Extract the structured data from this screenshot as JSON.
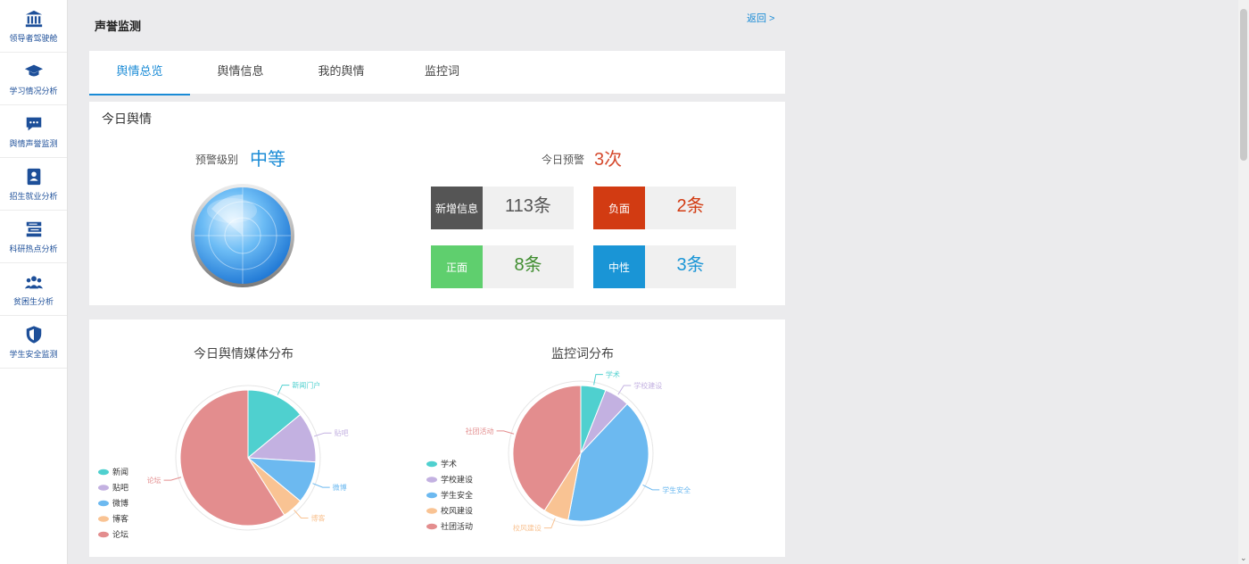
{
  "sidebar": {
    "items": [
      {
        "label": "领导者驾驶舱",
        "icon": "bank-icon"
      },
      {
        "label": "学习情况分析",
        "icon": "graduation-cap-icon"
      },
      {
        "label": "舆情声誉监测",
        "icon": "chat-bubble-icon"
      },
      {
        "label": "招生就业分析",
        "icon": "person-badge-icon"
      },
      {
        "label": "科研热点分析",
        "icon": "server-stack-icon"
      },
      {
        "label": "贫困生分析",
        "icon": "group-icon"
      },
      {
        "label": "学生安全监测",
        "icon": "shield-icon"
      }
    ],
    "accent": "#1d4f99"
  },
  "header": {
    "title": "声誉监测",
    "back": "返回 >"
  },
  "tabs": [
    {
      "label": "舆情总览",
      "active": true
    },
    {
      "label": "舆情信息",
      "active": false
    },
    {
      "label": "我的舆情",
      "active": false
    },
    {
      "label": "监控词",
      "active": false
    }
  ],
  "today": {
    "title": "今日舆情",
    "level_label": "预警级别",
    "level_value": "中等",
    "alert_label": "今日预警",
    "alert_value": "3次",
    "stats": [
      {
        "tag": "新增信息",
        "value": "113条",
        "tag_color": "#555555",
        "value_color": "#555555"
      },
      {
        "tag": "负面",
        "value": "2条",
        "tag_color": "#d23b12",
        "value_color": "#d23b12"
      },
      {
        "tag": "正面",
        "value": "8条",
        "tag_color": "#5fcf6e",
        "value_color": "#3f8d2f"
      },
      {
        "tag": "中性",
        "value": "3条",
        "tag_color": "#1a95d6",
        "value_color": "#1a95d6"
      }
    ]
  },
  "chart_data": [
    {
      "type": "pie",
      "title": "今日舆情媒体分布",
      "categories": [
        "新闻门户",
        "贴吧",
        "微博",
        "博客",
        "论坛"
      ],
      "legend": [
        "新闻",
        "贴吧",
        "微博",
        "博客",
        "论坛"
      ],
      "values": [
        14,
        12,
        10,
        5,
        59
      ],
      "colors": [
        "#4fd0cf",
        "#c3b1e1",
        "#6cb9f0",
        "#f9c393",
        "#e38d8e"
      ],
      "legend_position": "bottom-left"
    },
    {
      "type": "pie",
      "title": "监控词分布",
      "categories": [
        "学术",
        "学校建设",
        "学生安全",
        "校风建设",
        "社团活动"
      ],
      "legend": [
        "学术",
        "学校建设",
        "学生安全",
        "校风建设",
        "社团活动"
      ],
      "values": [
        6,
        6,
        41,
        6,
        41
      ],
      "colors": [
        "#4fd0cf",
        "#c3b1e1",
        "#6cb9f0",
        "#f9c393",
        "#e38d8e"
      ],
      "legend_position": "bottom-left"
    }
  ]
}
